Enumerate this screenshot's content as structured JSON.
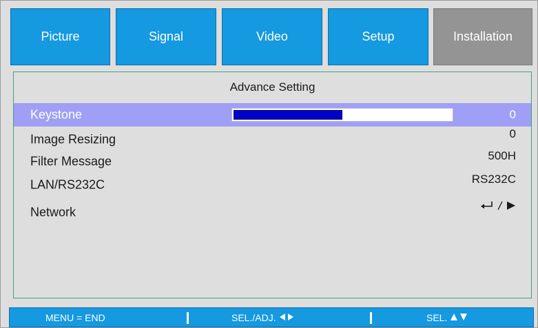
{
  "tabs": [
    {
      "label": "Picture",
      "active": false
    },
    {
      "label": "Signal",
      "active": false
    },
    {
      "label": "Video",
      "active": false
    },
    {
      "label": "Setup",
      "active": false
    },
    {
      "label": "Installation",
      "active": true
    }
  ],
  "panel": {
    "title": "Advance Setting",
    "rows": [
      {
        "label": "Keystone",
        "value": "0",
        "selected": true,
        "bar_fraction": 0.5
      },
      {
        "label": "Image Resizing",
        "value": "0",
        "selected": false
      },
      {
        "label": "Filter Message",
        "value": "500H",
        "selected": false
      },
      {
        "label": "LAN/RS232C",
        "value": "RS232C",
        "selected": false
      },
      {
        "label": "Network",
        "value": "",
        "selected": false,
        "icons": [
          "enter-icon",
          "slash-separator",
          "right-arrow-icon"
        ]
      }
    ]
  },
  "footer": {
    "hint_menu": "MENU = END",
    "hint_adjust": "SEL./ADJ.",
    "hint_select": "SEL."
  },
  "colors": {
    "tab": "#1599e0",
    "tab_active": "#949494",
    "selected_row": "#9f9ff5",
    "bar_fill": "#0000c8",
    "panel_bg": "#dedede"
  }
}
